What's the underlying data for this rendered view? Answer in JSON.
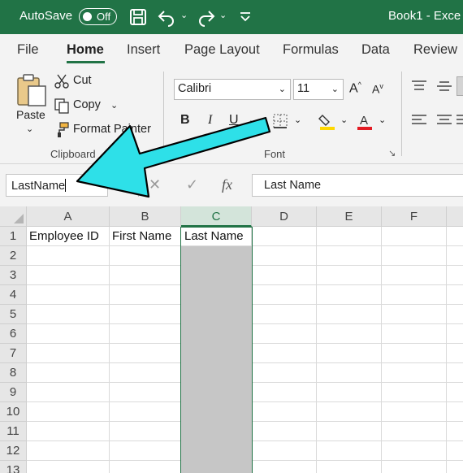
{
  "titlebar": {
    "autosave_label": "AutoSave",
    "autosave_state": "Off",
    "doc_title": "Book1 - Exce",
    "bg_color": "#217346"
  },
  "tabs": [
    "File",
    "Home",
    "Insert",
    "Page Layout",
    "Formulas",
    "Data",
    "Review"
  ],
  "active_tab": "Home",
  "ribbon": {
    "clipboard": {
      "paste_label": "Paste",
      "cut_label": "Cut",
      "copy_label": "Copy",
      "format_painter_label": "Format Painter",
      "group_label": "Clipboard"
    },
    "font": {
      "font_name": "Calibri",
      "font_size": "11",
      "bold": "B",
      "italic": "I",
      "underline": "U",
      "group_label": "Font",
      "highlight_color": "#ffd800",
      "font_color": "#e31b23"
    }
  },
  "formula_bar": {
    "name_box_value": "LastName",
    "formula_value": "Last Name",
    "fx_label": "fx"
  },
  "grid": {
    "columns": [
      "A",
      "B",
      "C",
      "D",
      "E",
      "F"
    ],
    "rows": [
      "1",
      "2",
      "3",
      "4",
      "5",
      "6",
      "7",
      "8",
      "9",
      "10",
      "11",
      "12",
      "13"
    ],
    "selected_column": "C",
    "cells": {
      "A1": "Employee ID",
      "B1": "First Name",
      "C1": "Last Name"
    }
  },
  "annotation": {
    "arrow_color": "#2ee0e8",
    "arrow_outline": "#000000"
  }
}
